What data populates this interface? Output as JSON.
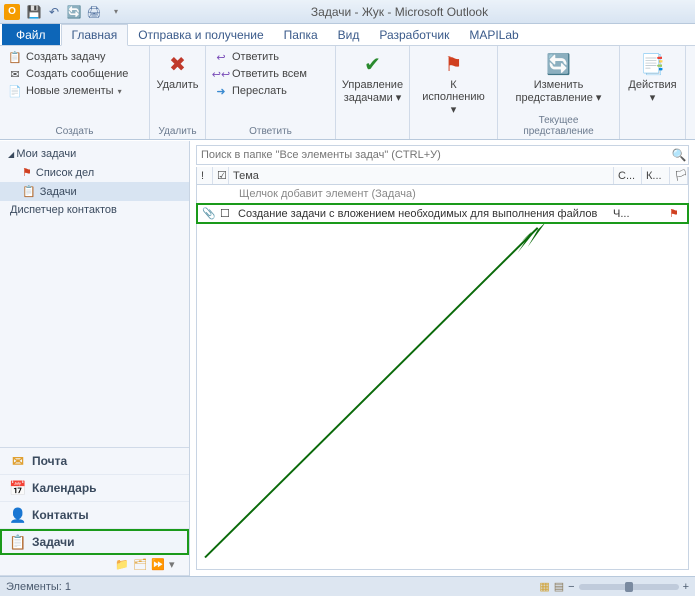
{
  "title": "Задачи - Жук - Microsoft Outlook",
  "tabs": {
    "file": "Файл",
    "home": "Главная",
    "sendreceive": "Отправка и получение",
    "folder": "Папка",
    "view": "Вид",
    "developer": "Разработчик",
    "mapilab": "MAPILab"
  },
  "ribbon": {
    "create": {
      "newTask": "Создать задачу",
      "newMessage": "Создать сообщение",
      "newItems": "Новые элементы",
      "group": "Создать"
    },
    "delete": {
      "label": "Удалить",
      "group": "Удалить"
    },
    "reply": {
      "reply": "Ответить",
      "replyAll": "Ответить всем",
      "forward": "Переслать",
      "group": "Ответить"
    },
    "manage": {
      "label1": "Управление",
      "label2": "задачами ▾",
      "group": "Управление задачами"
    },
    "followup": {
      "label1": "К",
      "label2": "исполнению ▾"
    },
    "represent": {
      "label1": "Изменить",
      "label2": "представление ▾",
      "group": "Текущее представление"
    },
    "actions": {
      "label": "Действия",
      "caret": "▾"
    }
  },
  "nav": {
    "header": "Мои задачи",
    "todoList": "Список дел",
    "tasks": "Задачи",
    "contactMgr": "Диспетчер контактов",
    "mail": "Почта",
    "calendar": "Календарь",
    "contacts": "Контакты",
    "tasksBig": "Задачи"
  },
  "search": {
    "placeholder": "Поиск в папке \"Все элементы задач\" (CTRL+У)"
  },
  "columns": {
    "icon": "!",
    "check": "☑",
    "subject": "Тема",
    "due": "С...",
    "cat": "К...",
    "flag": "🏳"
  },
  "prompt": "Щелчок добавит элемент (Задача)",
  "task": {
    "subject": "Создание задачи с вложением необходимых для выполнения файлов",
    "due": "Ч..."
  },
  "status": {
    "items": "Элементы: 1"
  }
}
